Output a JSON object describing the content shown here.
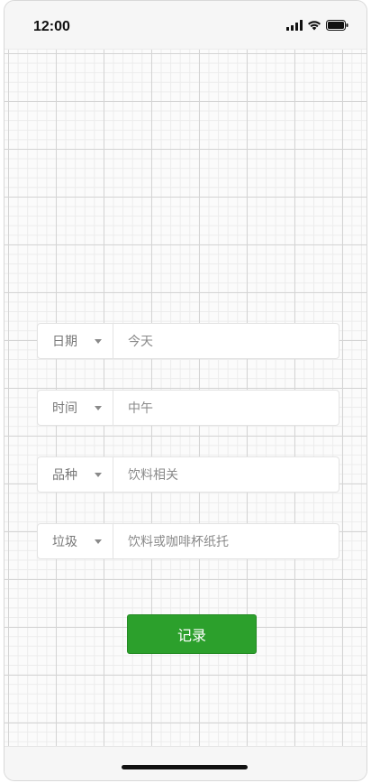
{
  "status_bar": {
    "time": "12:00",
    "icons": [
      "signal-icon",
      "wifi-icon",
      "battery-icon"
    ]
  },
  "form": {
    "fields": [
      {
        "label": "日期",
        "value": "今天"
      },
      {
        "label": "时间",
        "value": "中午"
      },
      {
        "label": "品种",
        "value": "饮料相关"
      },
      {
        "label": "垃圾",
        "value": "饮料或咖啡杯纸托"
      }
    ],
    "submit_label": "记录"
  },
  "colors": {
    "accent": "#2ca02c",
    "grid_major": "#d4d4d4",
    "grid_minor": "#ececec"
  }
}
